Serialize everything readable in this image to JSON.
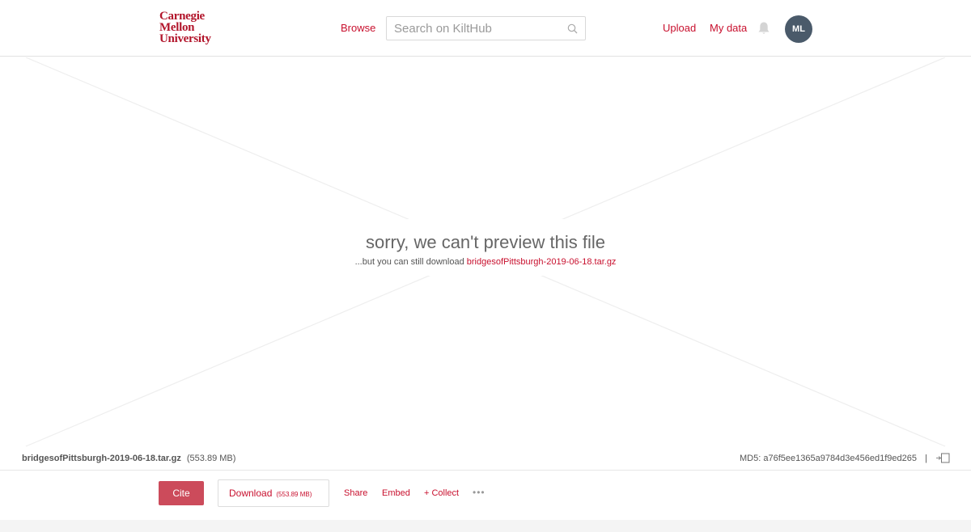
{
  "header": {
    "logo": [
      "Carnegie",
      "Mellon",
      "University"
    ],
    "browse_label": "Browse",
    "search_placeholder": "Search on KiltHub",
    "upload_label": "Upload",
    "my_data_label": "My data",
    "avatar_initials": "ML"
  },
  "preview": {
    "title": "sorry, we can't preview this file",
    "subtitle_prefix": "...but you can still download ",
    "file_link": "bridgesofPittsburgh-2019-06-18.tar.gz"
  },
  "file_bar": {
    "file_name": "bridgesofPittsburgh-2019-06-18.tar.gz",
    "file_size": "(553.89 MB)",
    "md5": "MD5: a76f5ee1365a9784d3e456ed1f9ed265",
    "separator": "|"
  },
  "actions": {
    "cite_label": "Cite",
    "download_label": "Download",
    "download_size": "(553.89 MB)",
    "share_label": "Share",
    "embed_label": "Embed",
    "collect_label": "+ Collect",
    "more_label": "•••"
  },
  "colors": {
    "brand_red": "#c8102e",
    "cite_button": "#cc4b5b",
    "avatar_bg": "#4a5a6a"
  }
}
